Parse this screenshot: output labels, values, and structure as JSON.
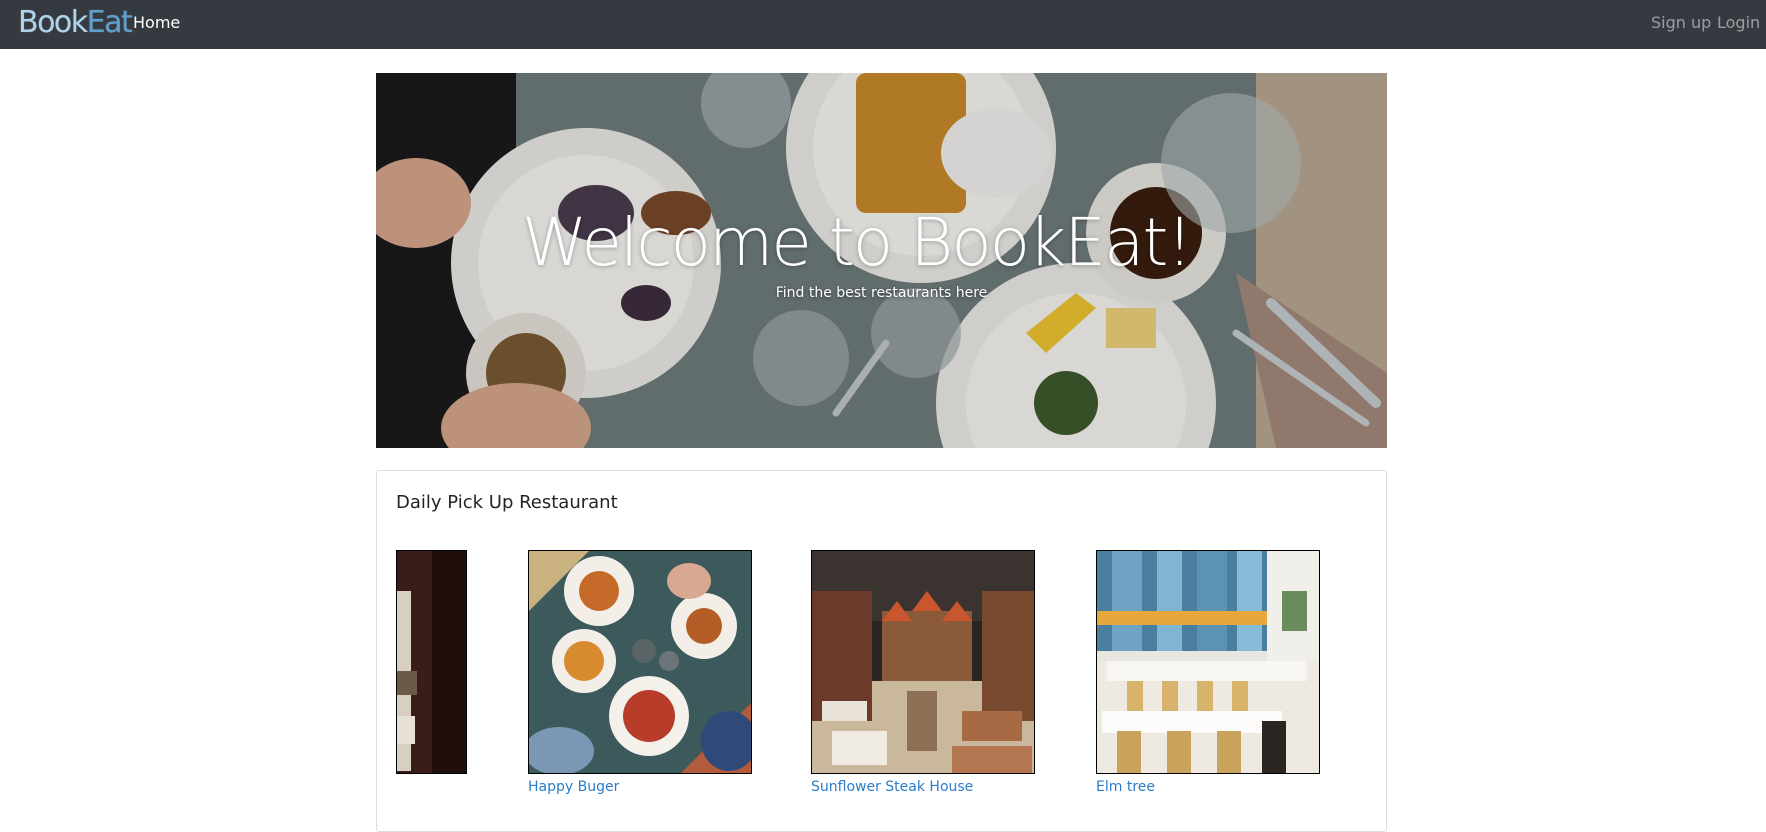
{
  "navbar": {
    "brand_book": "Book",
    "brand_eat": "Eat",
    "home_label": "Home",
    "signup_label": "Sign up",
    "login_label": "Login"
  },
  "hero": {
    "title": "Welcome to BookEat!",
    "subtitle": "Find the best restaurants here"
  },
  "daily_pick": {
    "title": "Daily Pick Up Restaurant",
    "restaurants": [
      {
        "name": ""
      },
      {
        "name": "Happy Buger"
      },
      {
        "name": "Sunflower Steak House"
      },
      {
        "name": "Elm tree"
      }
    ]
  },
  "colors": {
    "navbar_bg": "#343a40",
    "link": "#2a7dc9",
    "brand_light": "#aed4ea",
    "brand_dark": "#5e9fd0"
  }
}
